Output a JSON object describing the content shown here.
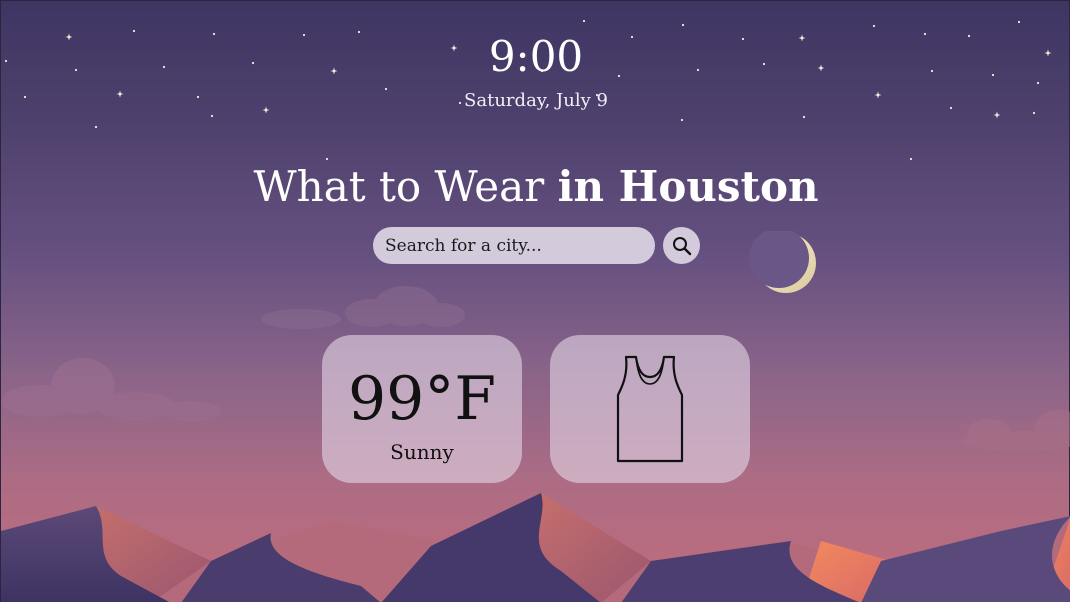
{
  "clock": {
    "time": "9:00",
    "date": "Saturday, July 9"
  },
  "headline": {
    "prefix": "What to Wear",
    "city": "in Houston"
  },
  "search": {
    "placeholder": "Search for a city..."
  },
  "weather": {
    "temperature": "99°F",
    "condition": "Sunny"
  },
  "icons": {
    "search": "search-icon",
    "moon": "crescent-moon-icon",
    "clothing": "tank-top-icon"
  },
  "colors": {
    "sky_top": "#3f3563",
    "sky_bottom": "#c06d7b",
    "card_bg": "#e2d4e4",
    "search_bg": "#d3cbdc",
    "moon": "#efe3c0"
  }
}
